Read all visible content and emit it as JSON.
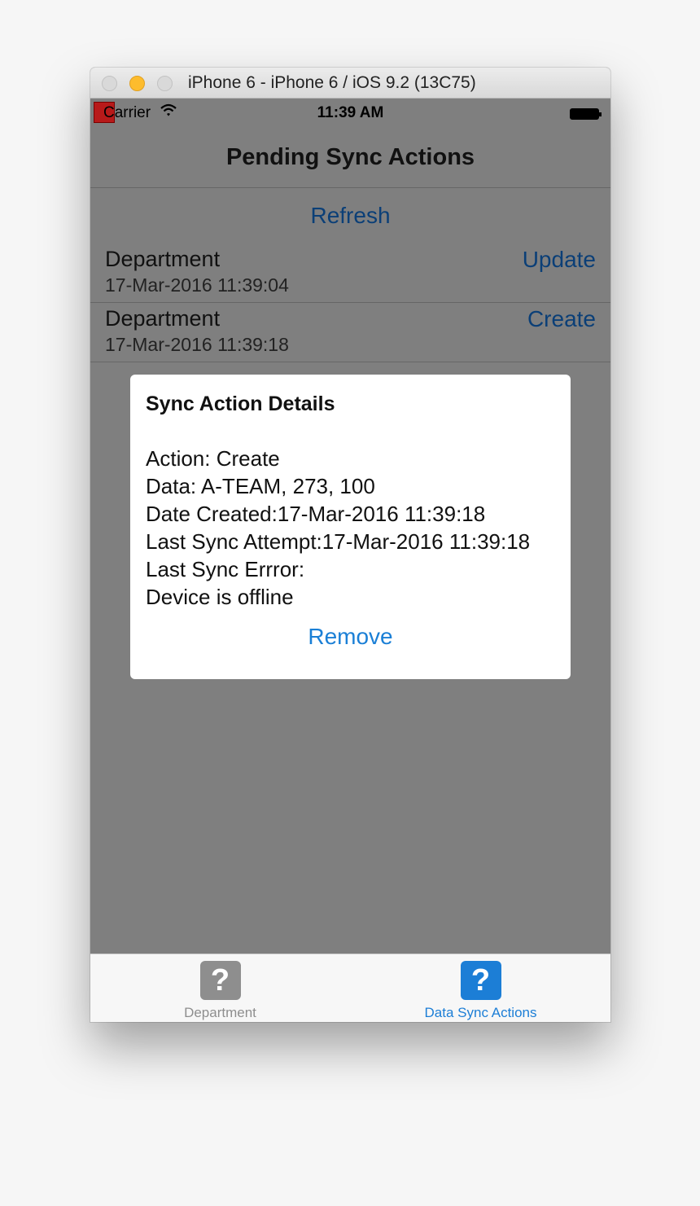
{
  "window": {
    "title": "iPhone 6 - iPhone 6 / iOS 9.2 (13C75)"
  },
  "status_bar": {
    "carrier": "Carrier",
    "time": "11:39 AM",
    "icons": [
      "wifi-icon",
      "battery-icon"
    ]
  },
  "navbar": {
    "title": "Pending Sync Actions"
  },
  "refresh_label": "Refresh",
  "rows": [
    {
      "entity": "Department",
      "timestamp": "17-Mar-2016 11:39:04",
      "action": "Update"
    },
    {
      "entity": "Department",
      "timestamp": "17-Mar-2016 11:39:18",
      "action": "Create"
    }
  ],
  "dialog": {
    "title": "Sync Action Details",
    "lines": [
      "Action: Create",
      "Data: A-TEAM, 273, 100",
      "Date Created:17-Mar-2016 11:39:18",
      "Last Sync Attempt:17-Mar-2016 11:39:18",
      "Last Sync Errror:",
      "Device is offline"
    ],
    "remove_label": "Remove"
  },
  "tabbar": {
    "tabs": [
      {
        "label": "Department",
        "icon": "question-icon",
        "selected": false
      },
      {
        "label": "Data Sync Actions",
        "icon": "question-icon",
        "selected": true
      }
    ]
  },
  "colors": {
    "accent": "#1c7ed6",
    "dimmed_accent": "#0b3f77",
    "overlay": "#7f7f7f"
  }
}
